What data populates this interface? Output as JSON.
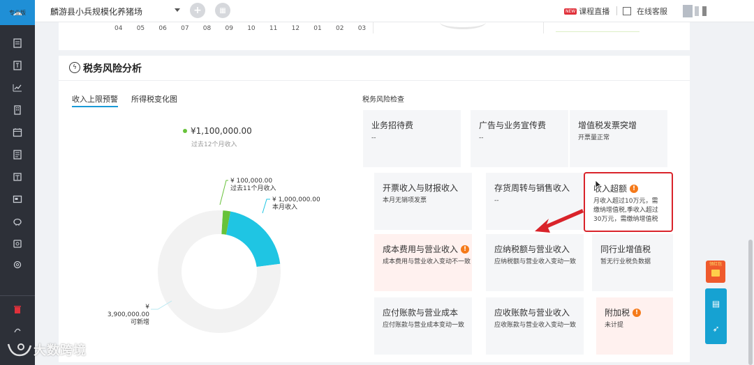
{
  "app": {
    "edition_label": "专业版"
  },
  "topbar": {
    "company": "麟游县小兵规模化养猪场",
    "live_badge": "NEW",
    "live_label": "课程直播",
    "service_label": "在线客服"
  },
  "upper_chart": {
    "months": [
      "04",
      "05",
      "06",
      "07",
      "08",
      "09",
      "10",
      "11",
      "12",
      "01",
      "02",
      "03"
    ]
  },
  "panel": {
    "title": "税务风险分析",
    "tabs": [
      {
        "label": "收入上限预警",
        "active": true
      },
      {
        "label": "所得税变化图",
        "active": false
      }
    ],
    "risk_section_title": "税务风险检查"
  },
  "income": {
    "total": "¥1,100,000.00",
    "total_label": "过去12个月收入"
  },
  "chart_data": {
    "type": "pie",
    "donut": true,
    "slices": [
      {
        "name": "过去11个月收入",
        "value": 100000,
        "label": "¥ 100,000.00",
        "color": "#67c23a"
      },
      {
        "name": "本月收入",
        "value": 1000000,
        "label": "¥ 1,000,000.00",
        "color": "#1fc5e3"
      },
      {
        "name": "可新增",
        "value": 3900000,
        "label": "¥ 3,900,000.00",
        "color": "#f2f2f2"
      }
    ]
  },
  "risks": [
    {
      "title": "业务招待费",
      "desc": "--",
      "alert": false
    },
    {
      "title": "广告与业务宣传费",
      "desc": "--",
      "alert": false
    },
    {
      "title": "增值税发票突增",
      "desc": "开票量正常",
      "alert": false
    },
    {
      "title": "开票收入与财报收入",
      "desc": "本月无销项发票",
      "alert": false
    },
    {
      "title": "存货周转与销售收入",
      "desc": "--",
      "alert": false
    },
    {
      "title": "收入超额",
      "desc": "月收入超过10万元，需缴纳增值税,季收入超过30万元，需缴纳增值税",
      "desc_lines": [
        "月收入超过10万元，需",
        "缴纳增值税,季收入超过",
        "30万元，需缴纳增值税"
      ],
      "alert": true
    },
    {
      "title": "成本费用与营业收入",
      "desc": "成本费用与营业收入变动不一致",
      "alert": true
    },
    {
      "title": "应纳税额与营业收入",
      "desc": "应纳税额与营业收入变动一致",
      "alert": false
    },
    {
      "title": "同行业增值税",
      "desc": "暂无行业税负数据",
      "alert": false
    },
    {
      "title": "应付账款与营业成本",
      "desc": "应付账款与营业成本变动一致",
      "alert": false
    },
    {
      "title": "应收账款与营业收入",
      "desc": "应收账款与营业收入变动一致",
      "alert": false
    },
    {
      "title": "附加税",
      "desc": "未计提",
      "alert": true
    }
  ],
  "float": {
    "redpacket_label": "领红包"
  },
  "watermark": {
    "text": "大数跨境"
  },
  "colors": {
    "accent": "#1a9ad6",
    "sidebar": "#2d3038",
    "alert_red": "#d9232a",
    "warn_orange": "#f57a1a"
  }
}
